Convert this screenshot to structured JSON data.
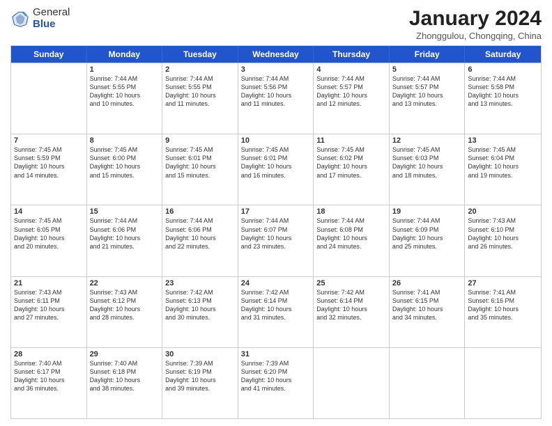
{
  "logo": {
    "general": "General",
    "blue": "Blue"
  },
  "header": {
    "title": "January 2024",
    "subtitle": "Zhonggulou, Chongqing, China"
  },
  "days": [
    "Sunday",
    "Monday",
    "Tuesday",
    "Wednesday",
    "Thursday",
    "Friday",
    "Saturday"
  ],
  "weeks": [
    [
      {
        "day": "",
        "info": ""
      },
      {
        "day": "1",
        "info": "Sunrise: 7:44 AM\nSunset: 5:55 PM\nDaylight: 10 hours\nand 10 minutes."
      },
      {
        "day": "2",
        "info": "Sunrise: 7:44 AM\nSunset: 5:55 PM\nDaylight: 10 hours\nand 11 minutes."
      },
      {
        "day": "3",
        "info": "Sunrise: 7:44 AM\nSunset: 5:56 PM\nDaylight: 10 hours\nand 11 minutes."
      },
      {
        "day": "4",
        "info": "Sunrise: 7:44 AM\nSunset: 5:57 PM\nDaylight: 10 hours\nand 12 minutes."
      },
      {
        "day": "5",
        "info": "Sunrise: 7:44 AM\nSunset: 5:57 PM\nDaylight: 10 hours\nand 13 minutes."
      },
      {
        "day": "6",
        "info": "Sunrise: 7:44 AM\nSunset: 5:58 PM\nDaylight: 10 hours\nand 13 minutes."
      }
    ],
    [
      {
        "day": "7",
        "info": "Sunrise: 7:45 AM\nSunset: 5:59 PM\nDaylight: 10 hours\nand 14 minutes."
      },
      {
        "day": "8",
        "info": "Sunrise: 7:45 AM\nSunset: 6:00 PM\nDaylight: 10 hours\nand 15 minutes."
      },
      {
        "day": "9",
        "info": "Sunrise: 7:45 AM\nSunset: 6:01 PM\nDaylight: 10 hours\nand 15 minutes."
      },
      {
        "day": "10",
        "info": "Sunrise: 7:45 AM\nSunset: 6:01 PM\nDaylight: 10 hours\nand 16 minutes."
      },
      {
        "day": "11",
        "info": "Sunrise: 7:45 AM\nSunset: 6:02 PM\nDaylight: 10 hours\nand 17 minutes."
      },
      {
        "day": "12",
        "info": "Sunrise: 7:45 AM\nSunset: 6:03 PM\nDaylight: 10 hours\nand 18 minutes."
      },
      {
        "day": "13",
        "info": "Sunrise: 7:45 AM\nSunset: 6:04 PM\nDaylight: 10 hours\nand 19 minutes."
      }
    ],
    [
      {
        "day": "14",
        "info": "Sunrise: 7:45 AM\nSunset: 6:05 PM\nDaylight: 10 hours\nand 20 minutes."
      },
      {
        "day": "15",
        "info": "Sunrise: 7:44 AM\nSunset: 6:06 PM\nDaylight: 10 hours\nand 21 minutes."
      },
      {
        "day": "16",
        "info": "Sunrise: 7:44 AM\nSunset: 6:06 PM\nDaylight: 10 hours\nand 22 minutes."
      },
      {
        "day": "17",
        "info": "Sunrise: 7:44 AM\nSunset: 6:07 PM\nDaylight: 10 hours\nand 23 minutes."
      },
      {
        "day": "18",
        "info": "Sunrise: 7:44 AM\nSunset: 6:08 PM\nDaylight: 10 hours\nand 24 minutes."
      },
      {
        "day": "19",
        "info": "Sunrise: 7:44 AM\nSunset: 6:09 PM\nDaylight: 10 hours\nand 25 minutes."
      },
      {
        "day": "20",
        "info": "Sunrise: 7:43 AM\nSunset: 6:10 PM\nDaylight: 10 hours\nand 26 minutes."
      }
    ],
    [
      {
        "day": "21",
        "info": "Sunrise: 7:43 AM\nSunset: 6:11 PM\nDaylight: 10 hours\nand 27 minutes."
      },
      {
        "day": "22",
        "info": "Sunrise: 7:43 AM\nSunset: 6:12 PM\nDaylight: 10 hours\nand 28 minutes."
      },
      {
        "day": "23",
        "info": "Sunrise: 7:42 AM\nSunset: 6:13 PM\nDaylight: 10 hours\nand 30 minutes."
      },
      {
        "day": "24",
        "info": "Sunrise: 7:42 AM\nSunset: 6:14 PM\nDaylight: 10 hours\nand 31 minutes."
      },
      {
        "day": "25",
        "info": "Sunrise: 7:42 AM\nSunset: 6:14 PM\nDaylight: 10 hours\nand 32 minutes."
      },
      {
        "day": "26",
        "info": "Sunrise: 7:41 AM\nSunset: 6:15 PM\nDaylight: 10 hours\nand 34 minutes."
      },
      {
        "day": "27",
        "info": "Sunrise: 7:41 AM\nSunset: 6:16 PM\nDaylight: 10 hours\nand 35 minutes."
      }
    ],
    [
      {
        "day": "28",
        "info": "Sunrise: 7:40 AM\nSunset: 6:17 PM\nDaylight: 10 hours\nand 36 minutes."
      },
      {
        "day": "29",
        "info": "Sunrise: 7:40 AM\nSunset: 6:18 PM\nDaylight: 10 hours\nand 38 minutes."
      },
      {
        "day": "30",
        "info": "Sunrise: 7:39 AM\nSunset: 6:19 PM\nDaylight: 10 hours\nand 39 minutes."
      },
      {
        "day": "31",
        "info": "Sunrise: 7:39 AM\nSunset: 6:20 PM\nDaylight: 10 hours\nand 41 minutes."
      },
      {
        "day": "",
        "info": ""
      },
      {
        "day": "",
        "info": ""
      },
      {
        "day": "",
        "info": ""
      }
    ]
  ]
}
